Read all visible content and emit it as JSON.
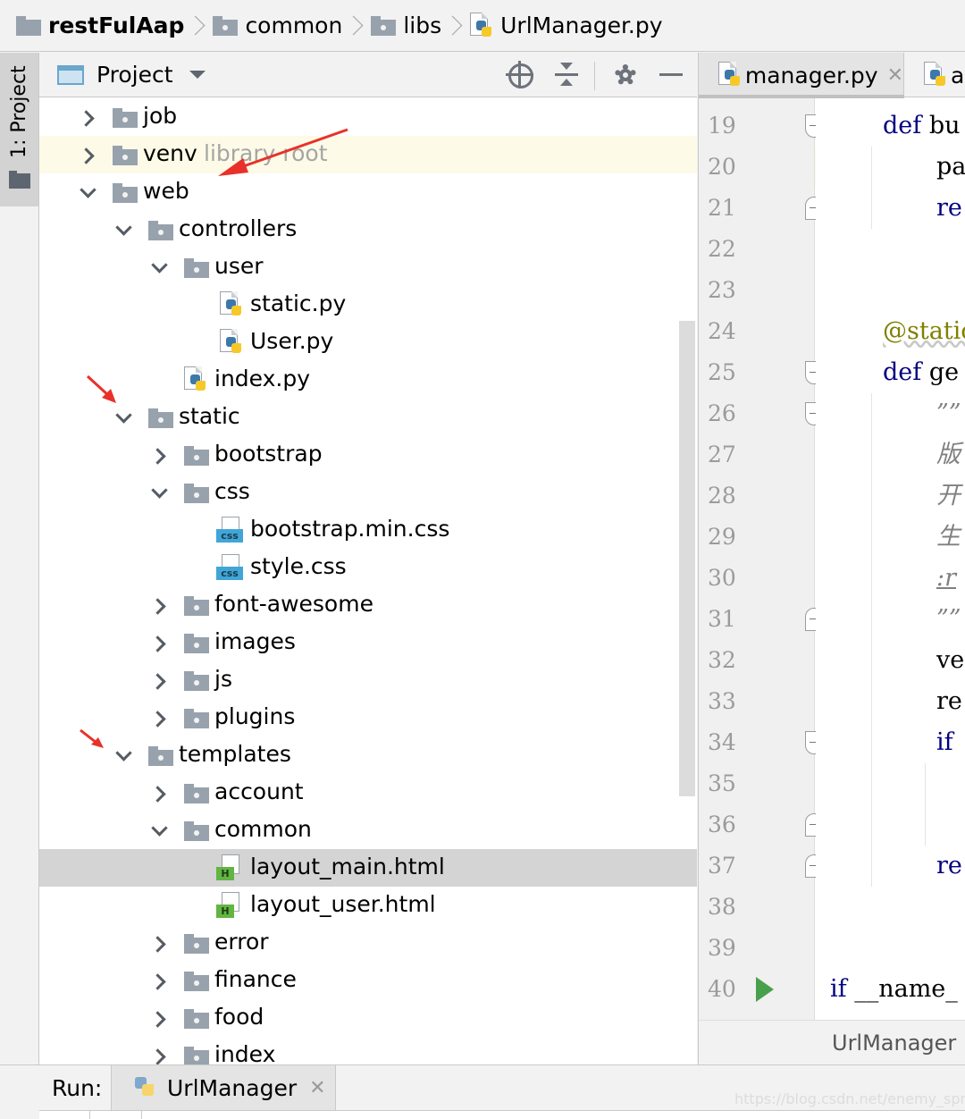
{
  "breadcrumb": [
    "restFulAap",
    "common",
    "libs",
    "UrlManager.py"
  ],
  "left_strip": {
    "project_tool": "1: Project"
  },
  "project_panel": {
    "title": "Project",
    "tree": [
      {
        "label": "job",
        "depth": 0,
        "type": "folder",
        "state": "collapsed"
      },
      {
        "label": "venv",
        "suffix": "library root",
        "depth": 0,
        "type": "folder",
        "state": "collapsed",
        "highlighted": true
      },
      {
        "label": "web",
        "depth": 0,
        "type": "folder",
        "state": "expanded"
      },
      {
        "label": "controllers",
        "depth": 1,
        "type": "folder",
        "state": "expanded"
      },
      {
        "label": "user",
        "depth": 2,
        "type": "folder",
        "state": "expanded"
      },
      {
        "label": "static.py",
        "depth": 3,
        "type": "py"
      },
      {
        "label": "User.py",
        "depth": 3,
        "type": "py"
      },
      {
        "label": "index.py",
        "depth": 2,
        "type": "py"
      },
      {
        "label": "static",
        "depth": 1,
        "type": "folder",
        "state": "expanded"
      },
      {
        "label": "bootstrap",
        "depth": 2,
        "type": "folder",
        "state": "collapsed"
      },
      {
        "label": "css",
        "depth": 2,
        "type": "folder",
        "state": "expanded"
      },
      {
        "label": "bootstrap.min.css",
        "depth": 3,
        "type": "css"
      },
      {
        "label": "style.css",
        "depth": 3,
        "type": "css"
      },
      {
        "label": "font-awesome",
        "depth": 2,
        "type": "folder",
        "state": "collapsed"
      },
      {
        "label": "images",
        "depth": 2,
        "type": "folder",
        "state": "collapsed"
      },
      {
        "label": "js",
        "depth": 2,
        "type": "folder",
        "state": "collapsed"
      },
      {
        "label": "plugins",
        "depth": 2,
        "type": "folder",
        "state": "collapsed"
      },
      {
        "label": "templates",
        "depth": 1,
        "type": "folder",
        "state": "expanded"
      },
      {
        "label": "account",
        "depth": 2,
        "type": "folder",
        "state": "collapsed"
      },
      {
        "label": "common",
        "depth": 2,
        "type": "folder",
        "state": "expanded"
      },
      {
        "label": "layout_main.html",
        "depth": 3,
        "type": "html",
        "selected": true
      },
      {
        "label": "layout_user.html",
        "depth": 3,
        "type": "html"
      },
      {
        "label": "error",
        "depth": 2,
        "type": "folder",
        "state": "collapsed"
      },
      {
        "label": "finance",
        "depth": 2,
        "type": "folder",
        "state": "collapsed"
      },
      {
        "label": "food",
        "depth": 2,
        "type": "folder",
        "state": "collapsed"
      },
      {
        "label": "index",
        "depth": 2,
        "type": "folder",
        "state": "collapsed"
      }
    ]
  },
  "editor": {
    "tabs": [
      {
        "label": "manager.py",
        "active": true
      },
      {
        "label": "ap"
      }
    ],
    "current_line": 20,
    "lines": [
      {
        "n": "19",
        "text": "def bu"
      },
      {
        "n": "20",
        "text": "pa"
      },
      {
        "n": "21",
        "text": "re"
      },
      {
        "n": "22",
        "text": ""
      },
      {
        "n": "23",
        "text": ""
      },
      {
        "n": "24",
        "text": "@static"
      },
      {
        "n": "25",
        "text": "def ge"
      },
      {
        "n": "26",
        "text": "””"
      },
      {
        "n": "27",
        "text": "版"
      },
      {
        "n": "28",
        "text": "开"
      },
      {
        "n": "29",
        "text": "生"
      },
      {
        "n": "30",
        "text": ":r"
      },
      {
        "n": "31",
        "text": "””"
      },
      {
        "n": "32",
        "text": "ve"
      },
      {
        "n": "33",
        "text": "re"
      },
      {
        "n": "34",
        "text": "if"
      },
      {
        "n": "35",
        "text": ""
      },
      {
        "n": "36",
        "text": ""
      },
      {
        "n": "37",
        "text": "re"
      },
      {
        "n": "38",
        "text": ""
      },
      {
        "n": "39",
        "text": ""
      },
      {
        "n": "40",
        "text": "if __name_"
      }
    ],
    "footer": "UrlManager"
  },
  "run_bar": {
    "label": "Run:",
    "tab": "UrlManager"
  },
  "watermark": "https://blog.csdn.net/enemy_sprites",
  "colors": {
    "keyword": "#000080",
    "decorator": "#808000",
    "docstring": "#808080",
    "run_arrow": "#49a04c",
    "annotation_arrow": "#e8312a",
    "line_highlight": "#fdfbe7",
    "selection": "#d4d4d4"
  }
}
